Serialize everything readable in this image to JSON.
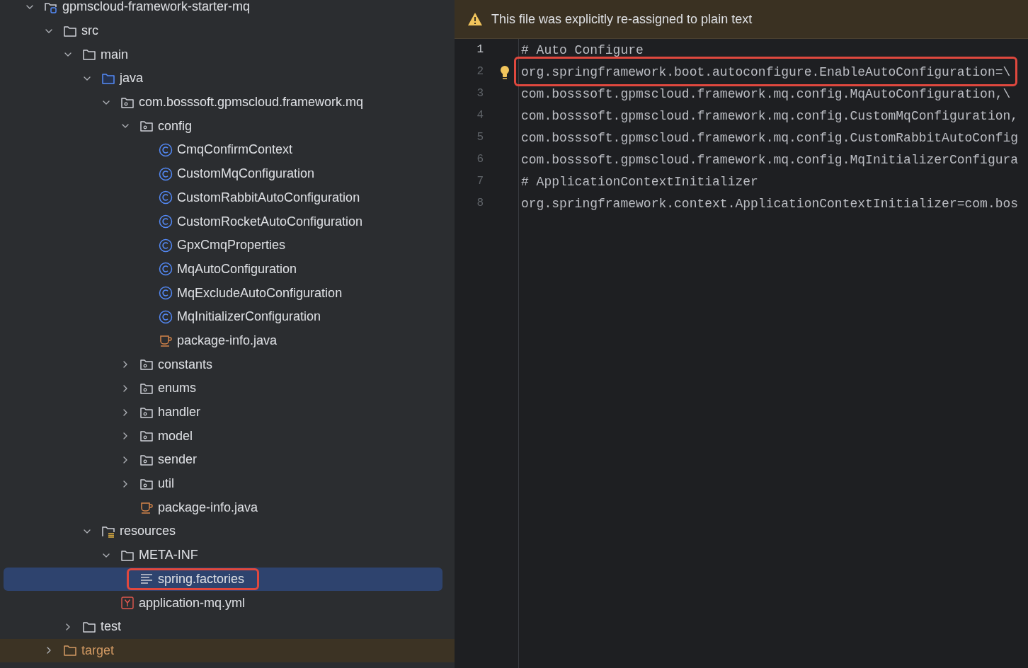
{
  "project_tree": [
    {
      "label": "gpmscloud-framework-starter-mq",
      "kind": "module",
      "expanded": true,
      "selected": false,
      "highlighted": false,
      "children": [
        {
          "label": "src",
          "kind": "folder",
          "expanded": true,
          "selected": false,
          "highlighted": false,
          "children": [
            {
              "label": "main",
              "kind": "folder",
              "expanded": true,
              "selected": false,
              "highlighted": false,
              "children": [
                {
                  "label": "java",
                  "kind": "source-folder",
                  "expanded": true,
                  "selected": false,
                  "highlighted": false,
                  "children": [
                    {
                      "label": "com.bosssoft.gpmscloud.framework.mq",
                      "kind": "package",
                      "expanded": true,
                      "selected": false,
                      "highlighted": false,
                      "children": [
                        {
                          "label": "config",
                          "kind": "package",
                          "expanded": true,
                          "selected": false,
                          "highlighted": false,
                          "children": [
                            {
                              "label": "CmqConfirmContext",
                              "kind": "class",
                              "selected": false,
                              "highlighted": false
                            },
                            {
                              "label": "CustomMqConfiguration",
                              "kind": "class",
                              "selected": false,
                              "highlighted": false
                            },
                            {
                              "label": "CustomRabbitAutoConfiguration",
                              "kind": "class",
                              "selected": false,
                              "highlighted": false
                            },
                            {
                              "label": "CustomRocketAutoConfiguration",
                              "kind": "class",
                              "selected": false,
                              "highlighted": false
                            },
                            {
                              "label": "GpxCmqProperties",
                              "kind": "class",
                              "selected": false,
                              "highlighted": false
                            },
                            {
                              "label": "MqAutoConfiguration",
                              "kind": "class",
                              "selected": false,
                              "highlighted": false
                            },
                            {
                              "label": "MqExcludeAutoConfiguration",
                              "kind": "class",
                              "selected": false,
                              "highlighted": false
                            },
                            {
                              "label": "MqInitializerConfiguration",
                              "kind": "class",
                              "selected": false,
                              "highlighted": false
                            },
                            {
                              "label": "package-info.java",
                              "kind": "java-file",
                              "selected": false,
                              "highlighted": false
                            }
                          ]
                        },
                        {
                          "label": "constants",
                          "kind": "package",
                          "expanded": false,
                          "selected": false,
                          "highlighted": false
                        },
                        {
                          "label": "enums",
                          "kind": "package",
                          "expanded": false,
                          "selected": false,
                          "highlighted": false
                        },
                        {
                          "label": "handler",
                          "kind": "package",
                          "expanded": false,
                          "selected": false,
                          "highlighted": false
                        },
                        {
                          "label": "model",
                          "kind": "package",
                          "expanded": false,
                          "selected": false,
                          "highlighted": false
                        },
                        {
                          "label": "sender",
                          "kind": "package",
                          "expanded": false,
                          "selected": false,
                          "highlighted": false
                        },
                        {
                          "label": "util",
                          "kind": "package",
                          "expanded": false,
                          "selected": false,
                          "highlighted": false
                        },
                        {
                          "label": "package-info.java",
                          "kind": "java-file",
                          "selected": false,
                          "highlighted": false
                        }
                      ]
                    }
                  ]
                },
                {
                  "label": "resources",
                  "kind": "resources",
                  "expanded": true,
                  "selected": false,
                  "highlighted": false,
                  "children": [
                    {
                      "label": "META-INF",
                      "kind": "folder",
                      "expanded": true,
                      "selected": false,
                      "highlighted": false,
                      "children": [
                        {
                          "label": "spring.factories",
                          "kind": "text-file",
                          "selected": true,
                          "highlighted": true
                        }
                      ]
                    },
                    {
                      "label": "application-mq.yml",
                      "kind": "yaml-file",
                      "selected": false,
                      "highlighted": false
                    }
                  ]
                }
              ]
            },
            {
              "label": "test",
              "kind": "folder",
              "expanded": false,
              "selected": false,
              "highlighted": false
            }
          ]
        },
        {
          "label": "target",
          "kind": "excluded-folder",
          "expanded": false,
          "selected": false,
          "highlighted": false
        }
      ]
    }
  ],
  "editor": {
    "banner": "This file was explicitly re-assigned to plain text",
    "code_lines": [
      {
        "number": "1",
        "text": "# Auto Configure",
        "current": true,
        "highlighted": false
      },
      {
        "number": "2",
        "text": "org.springframework.boot.autoconfigure.EnableAutoConfiguration=\\",
        "current": false,
        "highlighted": true
      },
      {
        "number": "3",
        "text": "com.bosssoft.gpmscloud.framework.mq.config.MqAutoConfiguration,\\",
        "current": false,
        "highlighted": false
      },
      {
        "number": "4",
        "text": "com.bosssoft.gpmscloud.framework.mq.config.CustomMqConfiguration,",
        "current": false,
        "highlighted": false
      },
      {
        "number": "5",
        "text": "com.bosssoft.gpmscloud.framework.mq.config.CustomRabbitAutoConfig",
        "current": false,
        "highlighted": false
      },
      {
        "number": "6",
        "text": "com.bosssoft.gpmscloud.framework.mq.config.MqInitializerConfigura",
        "current": false,
        "highlighted": false
      },
      {
        "number": "7",
        "text": "# ApplicationContextInitializer",
        "current": false,
        "highlighted": false
      },
      {
        "number": "8",
        "text": "org.springframework.context.ApplicationContextInitializer=com.bos",
        "current": false,
        "highlighted": false
      }
    ]
  }
}
